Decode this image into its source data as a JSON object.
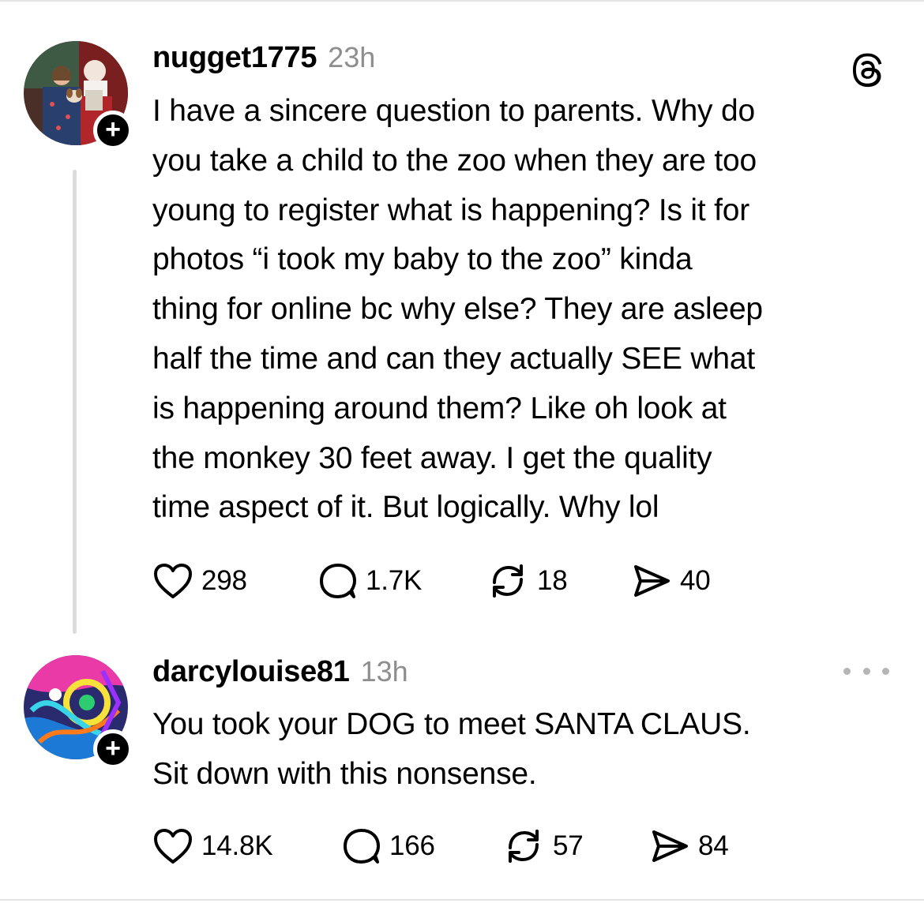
{
  "posts": [
    {
      "username": "nugget1775",
      "time": "23h",
      "text": "I have a sincere question to parents. Why do you take a child to the zoo when they are too young to register what is happening? Is it for photos “i took my baby to the zoo” kinda thing for online bc why else? They are asleep half the time and can they actually SEE what is happening around them? Like oh look at the monkey 30 feet away. I get the quality time aspect of it. But logically. Why lol",
      "lines": [
        "I have a sincere question to parents. Why do",
        "you take a child to the zoo when they are too",
        "young to register what is happening? Is it for",
        "photos “i took my baby to the zoo” kinda",
        "thing for online bc why else? They are asleep",
        "half the time and can they actually SEE what",
        "is happening around them? Like oh look at",
        "the monkey 30 feet away. I get the quality",
        "time aspect of it. But logically. Why lol"
      ],
      "likes": "298",
      "replies": "1.7K",
      "reposts": "18",
      "shares": "40"
    },
    {
      "username": "darcylouise81",
      "time": "13h",
      "lines": [
        "You took your DOG to meet SANTA CLAUS.",
        "Sit down with this nonsense."
      ],
      "likes": "14.8K",
      "replies": "166",
      "reposts": "57",
      "shares": "84"
    }
  ],
  "follow_badge": "+",
  "icons": {
    "brand": "threads-logo-icon",
    "menu": "more-options-icon",
    "like": "heart-icon",
    "reply": "comment-bubble-icon",
    "repost": "repost-arrows-icon",
    "share": "send-paper-plane-icon"
  },
  "colors": {
    "text": "#000000",
    "muted": "#8e8e8e",
    "thread_line": "#dcdcdc",
    "menu_dots": "#b5b5b5"
  }
}
